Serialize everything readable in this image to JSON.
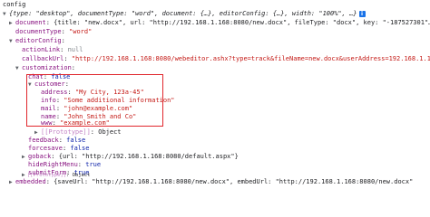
{
  "console": {
    "title": "config",
    "lines": [
      {
        "text": "{type: \"desktop\", documentType: \"word\", document: {…}, editorConfig: {…}, width: \"100%\", …}"
      },
      {
        "key": "document",
        "value": "{title: \"new.docx\", url: \"http://192.168.1.168:8080/new.docx\", fileType: \"docx\", key: \"-187527301\"…"
      },
      {
        "key": "documentType",
        "value": "\"word\""
      },
      {
        "key": "editorConfig"
      },
      {
        "key": "actionLink",
        "value": "null"
      },
      {
        "key": "callbackUrl",
        "value": "\"http://192.168.1.168:8080/webeditor.ashx?type=track&fileName=new.docx&userAddress=192.168.1.168\""
      },
      {
        "key": "customization"
      },
      {
        "key": "chat",
        "value": "false"
      },
      {
        "key": "customer"
      },
      {
        "key": "address",
        "value": "\"My City, 123a-45\""
      },
      {
        "key": "info",
        "value": "\"Some additional information\""
      },
      {
        "key": "mail",
        "value": "\"john@example.com\""
      },
      {
        "key": "name",
        "value": "\"John Smith and Co\""
      },
      {
        "key": "www",
        "value": "\"example.com\""
      },
      {
        "key": "[[Prototype]]",
        "value": "Object"
      },
      {
        "key": "feedback",
        "value": "false"
      },
      {
        "key": "forcesave",
        "value": "false"
      },
      {
        "key": "goback",
        "value": "{url: \"http://192.168.1.168:8080/default.aspx\"}"
      },
      {
        "key": "hideRightMenu",
        "value": "true"
      },
      {
        "key": "submitForm",
        "value": "true"
      },
      {
        "key": "[[Prototype]]",
        "value": "Object"
      },
      {
        "key": "embedded",
        "value": "{saveUrl: \"http://192.168.1.168:8080/new.docx\", embedUrl: \"http://192.168.1.168:8080/new.docx\""
      }
    ]
  },
  "info_icon_label": "i",
  "colors": {
    "highlight": "#e0262c",
    "key": "#881280",
    "string": "#c41a16",
    "number": "#1c00cf"
  }
}
